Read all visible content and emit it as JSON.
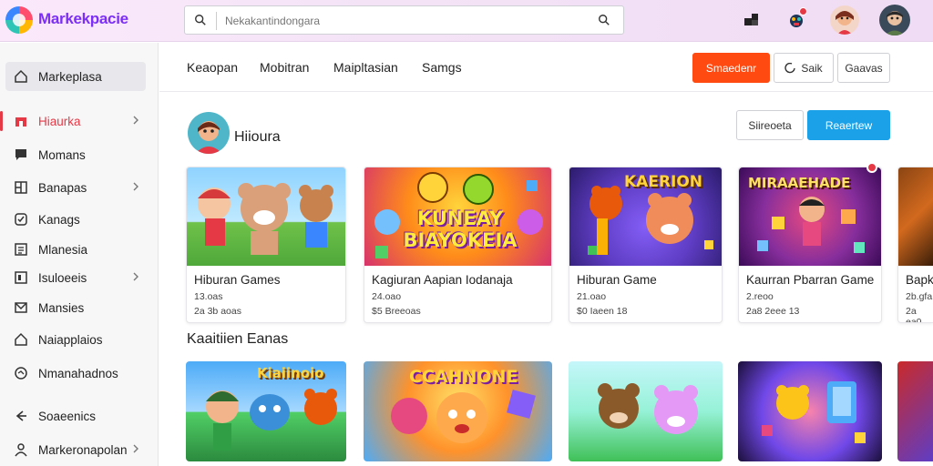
{
  "brand": {
    "name": "Markekpacie"
  },
  "search": {
    "placeholder": "Nekakantindongara"
  },
  "sidebar": {
    "items": [
      {
        "label": "Markeplasa",
        "icon": "home-icon"
      },
      {
        "label": "Hiaurka",
        "icon": "store-icon"
      },
      {
        "label": "Momans",
        "icon": "chat-icon"
      },
      {
        "label": "Banapas",
        "icon": "grid-icon"
      },
      {
        "label": "Kanags",
        "icon": "check-icon"
      },
      {
        "label": "Mlanesia",
        "icon": "list-icon"
      },
      {
        "label": "Isuloeeis",
        "icon": "box-icon"
      },
      {
        "label": "Mansies",
        "icon": "mail-icon"
      },
      {
        "label": "Naiapplaios",
        "icon": "house-icon"
      },
      {
        "label": "Nmanahadnos",
        "icon": "globe-icon"
      },
      {
        "label": "Soaeenics",
        "icon": "share-icon"
      },
      {
        "label": "Markeronapolan",
        "icon": "person-icon"
      }
    ]
  },
  "tabs": [
    "Keaopan",
    "Mobitran",
    "Maipltasian",
    "Samgs"
  ],
  "header_buttons": {
    "primary": "Smaedenr",
    "secondary": "Saik",
    "tertiary": "Gaavas"
  },
  "profile": {
    "name": "Hiioura",
    "button_outline": "Siireoeta",
    "button_blue": "Reaertew"
  },
  "section2_title": "Kaaitiien Eanas",
  "cards": [
    {
      "title": "Hiburan Games",
      "line1": "13.oas",
      "line2": "2a  3b  aoas"
    },
    {
      "title": "Kagiuran Aapian Iodanaja",
      "line1": "24.oao",
      "line2": "$5  Breeoas"
    },
    {
      "title": "Hiburan Game",
      "line1": "21.oao",
      "line2": "$0  Iaeen 18"
    },
    {
      "title": "Kaurran Pbarran Game",
      "line1": "2.reoo",
      "line2": "2a8  2eee 13"
    },
    {
      "title": "Bapk",
      "line1": "2b.gfa",
      "line2": "2a  ea0"
    }
  ],
  "card_thumb_texts": [
    "",
    "KUNEAY BIAYOKEIA",
    "KAERION",
    "MIRAAEHADE"
  ],
  "row2_thumb_texts": [
    "Kiaiinoio",
    "CCAHNONE",
    "",
    ""
  ],
  "colors": {
    "accent_red": "#ff4a12",
    "accent_blue": "#1ba1e8",
    "active_red": "#e63946",
    "brand_purple": "#7b2ff7"
  }
}
